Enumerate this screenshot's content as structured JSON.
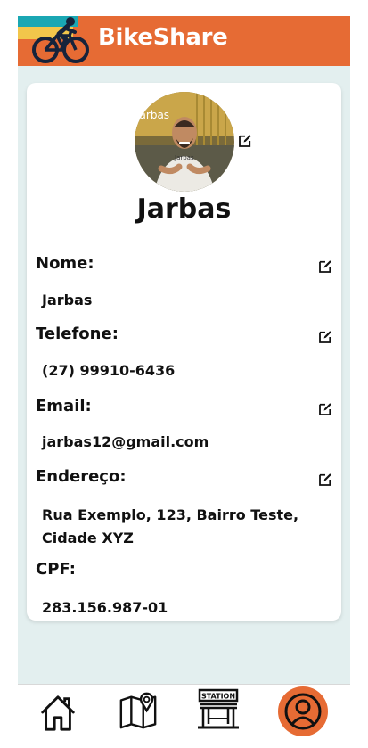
{
  "app": {
    "title": "BikeShare",
    "accent_color": "#e66b34"
  },
  "profile": {
    "name": "Jarbas",
    "avatar_shirt_text": "Jarbas",
    "avatar_wall_text": "Jarbas"
  },
  "fields": [
    {
      "label": "Nome:",
      "value": "Jarbas",
      "editable": true
    },
    {
      "label": "Telefone:",
      "value": "(27) 99910-6436",
      "editable": true
    },
    {
      "label": "Email:",
      "value": "jarbas12@gmail.com",
      "editable": true
    },
    {
      "label": "Endereço:",
      "value_line1": "Rua Exemplo, 123, Bairro Teste,",
      "value_line2": "Cidade XYZ",
      "editable": true
    },
    {
      "label": "CPF:",
      "value": "283.156.987-01",
      "editable": false
    }
  ],
  "bottom_nav": {
    "items": [
      {
        "icon": "home-icon"
      },
      {
        "icon": "map-icon"
      },
      {
        "icon": "station-icon",
        "label": "STATION"
      },
      {
        "icon": "user-icon",
        "active": true
      }
    ]
  }
}
